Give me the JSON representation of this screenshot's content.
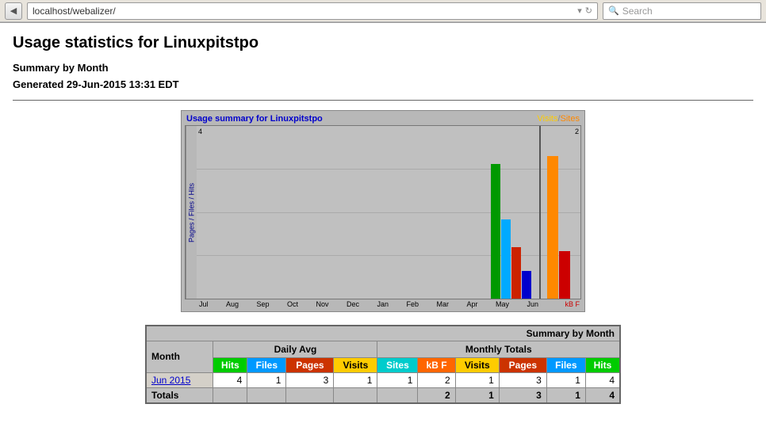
{
  "browser": {
    "back_button": "◀",
    "url": "localhost/webalizer/",
    "dropdown_icon": "▾",
    "refresh_icon": "↻",
    "search_placeholder": "Search"
  },
  "page": {
    "title": "Usage statistics for Linuxpitstpo",
    "summary_label": "Summary by Month",
    "generated": "Generated 29-Jun-2015 13:31 EDT"
  },
  "chart": {
    "title": "Usage summary for Linuxpitstpo",
    "legend_visits": "Visits",
    "legend_slash": "/",
    "legend_sites": "Sites",
    "y_label": "Pages / Files / Hits",
    "x_labels": [
      "Jul",
      "Aug",
      "Sep",
      "Oct",
      "Nov",
      "Dec",
      "Jan",
      "Feb",
      "Mar",
      "Apr",
      "May",
      "Jun"
    ],
    "right_label": "kB F",
    "y_top_left": "4",
    "y_top_right": "2"
  },
  "table": {
    "title": "Summary by Month",
    "col_month": "Month",
    "group_daily": "Daily Avg",
    "group_monthly": "Monthly Totals",
    "headers": {
      "hits": "Hits",
      "files": "Files",
      "pages": "Pages",
      "visits": "Visits",
      "sites": "Sites",
      "kbf": "kB F",
      "visits2": "Visits",
      "pages2": "Pages",
      "files2": "Files",
      "hits2": "Hits"
    },
    "rows": [
      {
        "month": "Jun 2015",
        "month_link": "#",
        "hits": "4",
        "files": "1",
        "pages": "3",
        "visits": "1",
        "sites": "1",
        "kbf": "2",
        "visits2": "1",
        "pages2": "3",
        "files2": "1",
        "hits2": "4"
      }
    ],
    "totals": {
      "label": "Totals",
      "kbf": "2",
      "visits": "1",
      "pages": "3",
      "files": "1",
      "hits": "4"
    }
  }
}
